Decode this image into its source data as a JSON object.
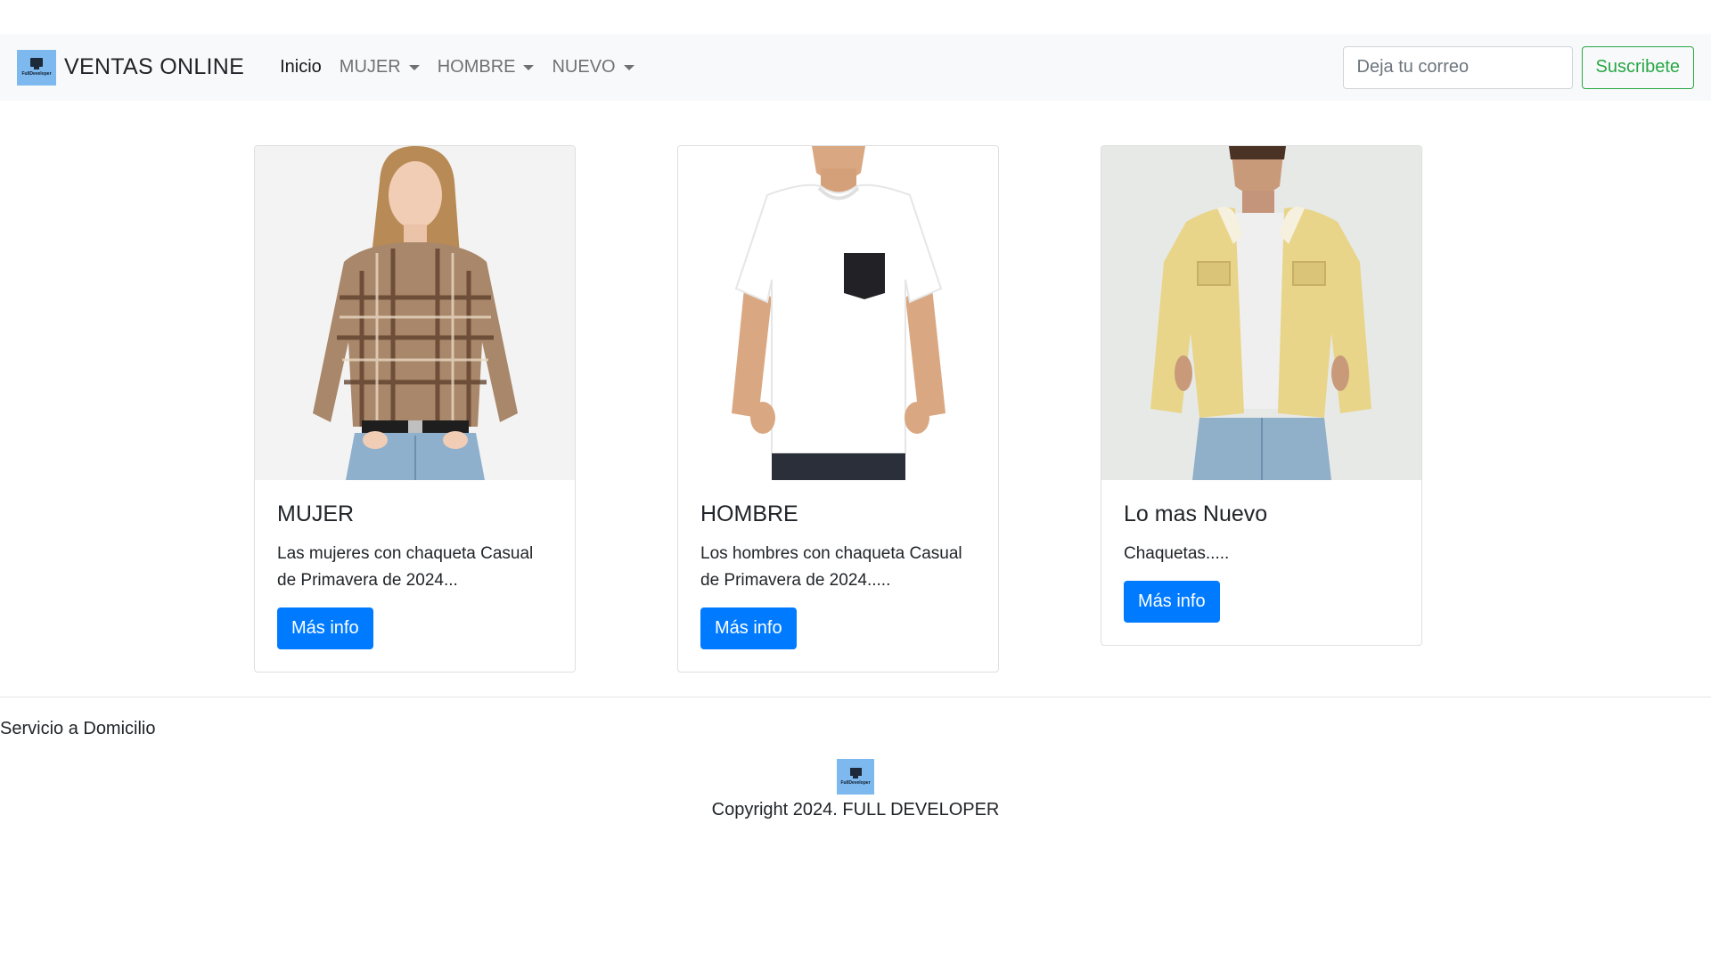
{
  "navbar": {
    "brand": "VENTAS ONLINE",
    "logo_text": "FullDeveloper",
    "links": [
      {
        "label": "Inicio",
        "active": true,
        "dropdown": false
      },
      {
        "label": "MUJER",
        "active": false,
        "dropdown": true
      },
      {
        "label": "HOMBRE",
        "active": false,
        "dropdown": true
      },
      {
        "label": "NUEVO",
        "active": false,
        "dropdown": true
      }
    ],
    "email_placeholder": "Deja tu correo",
    "subscribe_label": "Suscribete"
  },
  "cards": [
    {
      "title": "MUJER",
      "text": "Las mujeres con chaqueta Casual de Primavera de 2024...",
      "button": "Más info",
      "image": "woman-plaid-shirt"
    },
    {
      "title": "HOMBRE",
      "text": "Los hombres con chaqueta Casual de Primavera de 2024.....",
      "button": "Más info",
      "image": "man-white-tshirt"
    },
    {
      "title": "Lo mas Nuevo",
      "text": "Chaquetas.....",
      "button": "Más info",
      "image": "man-yellow-jacket"
    }
  ],
  "footer": {
    "service": "Servicio a Domicilio",
    "logo_text": "FullDeveloper",
    "copyright": "Copyright 2024. FULL DEVELOPER"
  },
  "colors": {
    "primary": "#007bff",
    "success": "#28a745",
    "navbar_bg": "#f8f9fa",
    "logo_bg": "#7db8ee"
  }
}
